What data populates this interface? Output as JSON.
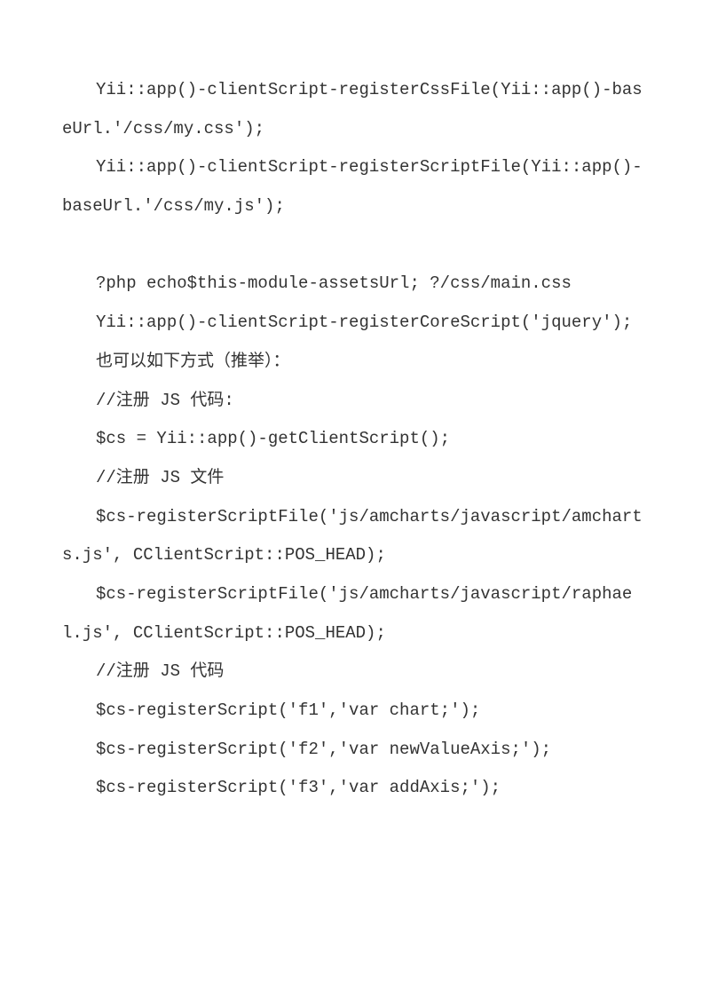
{
  "lines": [
    {
      "text": "Yii::app()-clientScript-registerCssFile(Yii::app()-baseUrl.'/css/my.css');",
      "indent": true
    },
    {
      "text": "Yii::app()-clientScript-registerScriptFile(Yii::app()-baseUrl.'/css/my.js');",
      "indent": true
    },
    {
      "text": "",
      "indent": false
    },
    {
      "text": "?php echo$this-module-assetsUrl; ?/css/main.css",
      "indent": true
    },
    {
      "text": "Yii::app()-clientScript-registerCoreScript('jquery');",
      "indent": true
    },
    {
      "text": "也可以如下方式（推举）：",
      "indent": true
    },
    {
      "text": "//注册 JS 代码:",
      "indent": true
    },
    {
      "text": "$cs = Yii::app()-getClientScript();",
      "indent": true
    },
    {
      "text": "//注册 JS 文件",
      "indent": true
    },
    {
      "text": "$cs-registerScriptFile('js/amcharts/javascript/amcharts.js', CClientScript::POS_HEAD);",
      "indent": true
    },
    {
      "text": "$cs-registerScriptFile('js/amcharts/javascript/raphael.js', CClientScript::POS_HEAD);",
      "indent": true
    },
    {
      "text": "//注册 JS 代码",
      "indent": true
    },
    {
      "text": "$cs-registerScript('f1','var chart;');",
      "indent": true
    },
    {
      "text": "$cs-registerScript('f2','var newValueAxis;');",
      "indent": true
    },
    {
      "text": "$cs-registerScript('f3','var addAxis;');",
      "indent": true
    }
  ]
}
